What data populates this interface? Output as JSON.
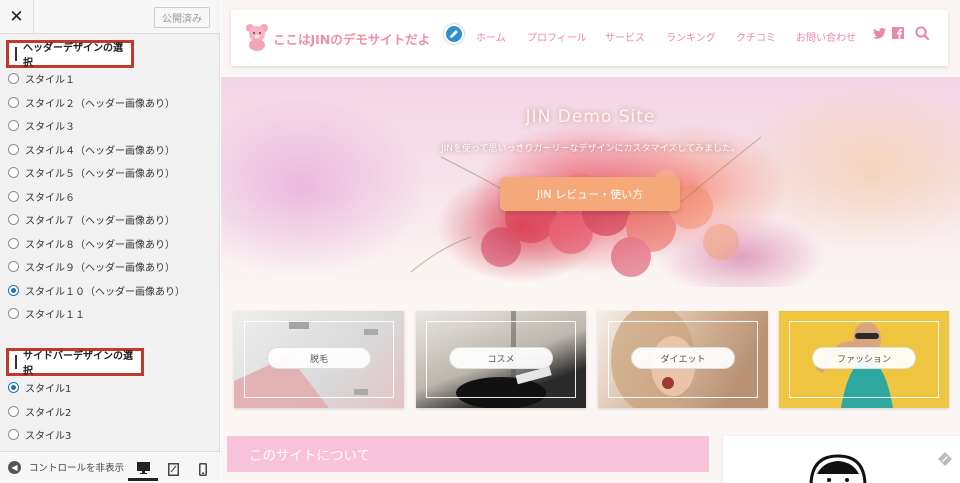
{
  "sidebar": {
    "publish_label": "公開済み",
    "header_section": {
      "title": "ヘッダーデザインの選択",
      "options": [
        {
          "label": "スタイル１",
          "checked": false
        },
        {
          "label": "スタイル２（ヘッダー画像あり）",
          "checked": false
        },
        {
          "label": "スタイル３",
          "checked": false
        },
        {
          "label": "スタイル４（ヘッダー画像あり）",
          "checked": false
        },
        {
          "label": "スタイル５（ヘッダー画像あり）",
          "checked": false
        },
        {
          "label": "スタイル６",
          "checked": false
        },
        {
          "label": "スタイル７（ヘッダー画像あり）",
          "checked": false
        },
        {
          "label": "スタイル８（ヘッダー画像あり）",
          "checked": false
        },
        {
          "label": "スタイル９（ヘッダー画像あり）",
          "checked": false
        },
        {
          "label": "スタイル１０（ヘッダー画像あり）",
          "checked": true
        },
        {
          "label": "スタイル１１",
          "checked": false
        }
      ]
    },
    "sidebar_section": {
      "title": "サイドバーデザインの選択",
      "options": [
        {
          "label": "スタイル1",
          "checked": true
        },
        {
          "label": "スタイル2",
          "checked": false
        },
        {
          "label": "スタイル3",
          "checked": false
        }
      ]
    },
    "footer": {
      "hide_controls_label": "コントロールを非表示",
      "devices": [
        "desktop-icon",
        "tablet-icon",
        "mobile-icon"
      ]
    }
  },
  "site": {
    "logo_text": "ここはJINのデモサイトだよ",
    "nav": [
      "ホーム",
      "プロフィール",
      "サービス",
      "ランキング",
      "クチコミ",
      "お問い合わせ"
    ],
    "header_icons": [
      "twitter-icon",
      "facebook-icon",
      "search-icon"
    ],
    "hero": {
      "title": "JIN Demo Site",
      "subtitle": "JINを使って思いっきりガーリーなデザインにカスタマイズしてみました。",
      "button": "JIN レビュー・使い方"
    },
    "categories": [
      "脱毛",
      "コスメ",
      "ダイエット",
      "ファッション"
    ],
    "about_title": "このサイトについて"
  },
  "colors": {
    "accent_pink": "#ee8fa6",
    "hero_button": "#f5a87a",
    "about_bar": "#f8c2da",
    "radio_selected": "#2271b1",
    "highlight_box": "#c0392b"
  }
}
